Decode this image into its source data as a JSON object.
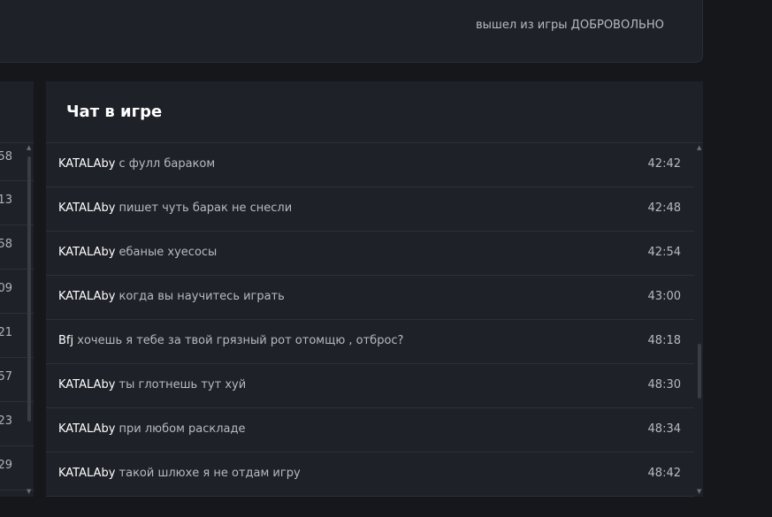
{
  "top_panel": {
    "note": "вышел из игры ДОБРОВОЛЬНО"
  },
  "left_panel": {
    "values": [
      "58",
      "13",
      "58",
      "09",
      "21",
      "57",
      "23",
      "29"
    ]
  },
  "chat": {
    "title": "Чат в игре",
    "messages": [
      {
        "author": "KATALAby",
        "text": "с фулл бараком",
        "time": "42:42"
      },
      {
        "author": "KATALAby",
        "text": "пишет чуть барак не снесли",
        "time": "42:48"
      },
      {
        "author": "KATALAby",
        "text": "ебаные хуесосы",
        "time": "42:54"
      },
      {
        "author": "KATALAby",
        "text": "когда вы научитесь играть",
        "time": "43:00"
      },
      {
        "author": "Bfj",
        "text": "хочешь я тебе за твой грязный рот отомщю , отброс?",
        "time": "48:18"
      },
      {
        "author": "KATALAby",
        "text": "ты глотнешь тут хуй",
        "time": "48:30"
      },
      {
        "author": "KATALAby",
        "text": "при любом раскладе",
        "time": "48:34"
      },
      {
        "author": "KATALAby",
        "text": "такой шлюхе я не отдам игру",
        "time": "48:42"
      }
    ]
  },
  "colors": {
    "page_bg": "#16171b",
    "panel_bg": "#1f2128",
    "divider": "#2d3038",
    "author": "#ffffff",
    "text": "#b8bac0"
  }
}
